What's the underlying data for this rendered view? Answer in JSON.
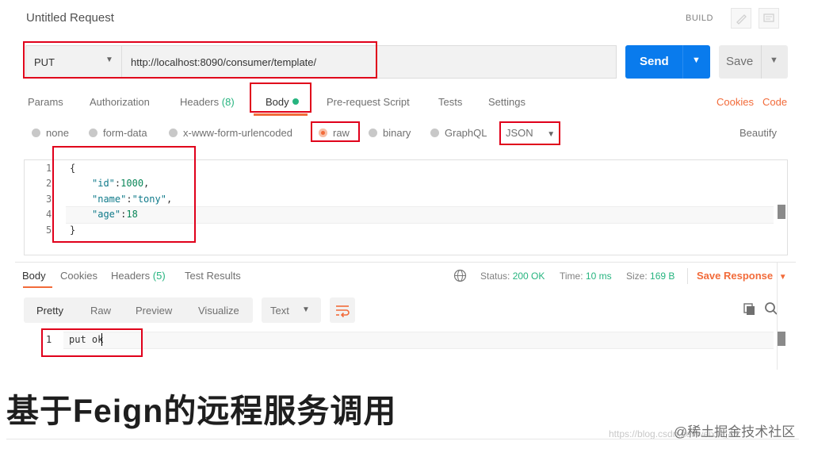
{
  "header": {
    "title": "Untitled Request",
    "build": "BUILD"
  },
  "request": {
    "method": "PUT",
    "url": "http://localhost:8090/consumer/template/",
    "send_label": "Send",
    "save_label": "Save"
  },
  "request_tabs": {
    "params": "Params",
    "authorization": "Authorization",
    "headers": "Headers",
    "headers_count": "(8)",
    "body": "Body",
    "prerequest": "Pre-request Script",
    "tests": "Tests",
    "settings": "Settings",
    "cookies": "Cookies",
    "code": "Code"
  },
  "body_types": {
    "none": "none",
    "form_data": "form-data",
    "urlencoded": "x-www-form-urlencoded",
    "raw": "raw",
    "binary": "binary",
    "graphql": "GraphQL",
    "format": "JSON",
    "beautify": "Beautify",
    "selected": "raw"
  },
  "editor": {
    "lines": [
      "1",
      "2",
      "3",
      "4",
      "5"
    ],
    "open_brace": "{",
    "close_brace": "}",
    "id_key": "\"id\"",
    "id_val": "1000",
    "name_key": "\"name\"",
    "name_val": "\"tony\"",
    "age_key": "\"age\"",
    "age_val": "18"
  },
  "response_tabs": {
    "body": "Body",
    "cookies": "Cookies",
    "headers": "Headers",
    "headers_count": "(5)",
    "test_results": "Test Results"
  },
  "response_status": {
    "status_label": "Status:",
    "status_value": "200 OK",
    "time_label": "Time:",
    "time_value": "10 ms",
    "size_label": "Size:",
    "size_value": "169 B",
    "save_response": "Save Response"
  },
  "view_modes": {
    "pretty": "Pretty",
    "raw": "Raw",
    "preview": "Preview",
    "visualize": "Visualize",
    "text_format": "Text"
  },
  "response_body": {
    "line": "1",
    "text": "put ok"
  },
  "caption": "基于Feign的远程服务调用",
  "watermark": "@稀土掘金技术社区",
  "url_watermark": "https://blog.csdn.net/weixin_43"
}
